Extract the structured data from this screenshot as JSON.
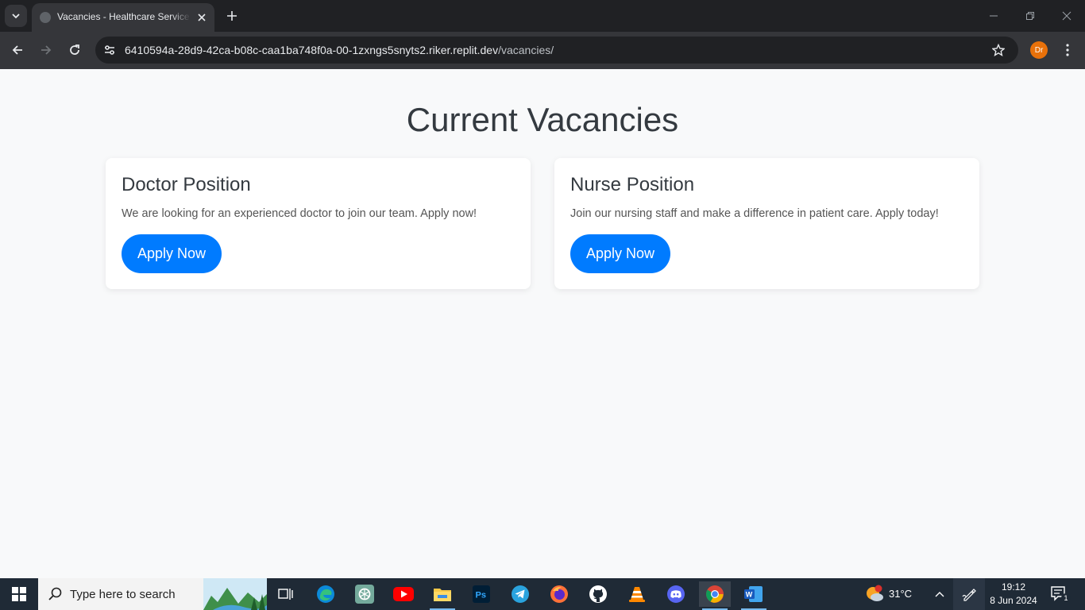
{
  "browser": {
    "tab_title": "Vacancies - Healthcare Service Management",
    "url_host": "6410594a-28d9-42ca-b08c-caa1ba748f0a-00-1zxngs5snyts2.riker.replit.dev",
    "url_path": "/vacancies/",
    "profile_initials": "Dr"
  },
  "page": {
    "title": "Current Vacancies",
    "vacancies": [
      {
        "title": "Doctor Position",
        "description": "We are looking for an experienced doctor to join our team. Apply now!",
        "button_label": "Apply Now"
      },
      {
        "title": "Nurse Position",
        "description": "Join our nursing staff and make a difference in patient care. Apply today!",
        "button_label": "Apply Now"
      }
    ]
  },
  "taskbar": {
    "search_placeholder": "Type here to search",
    "weather": "31°C",
    "time": "19:12",
    "date": "8 Jun 2024",
    "notification_count": "1",
    "apps": [
      "task-view-icon",
      "edge-icon",
      "chatgpt-icon",
      "youtube-icon",
      "file-explorer-icon",
      "photoshop-icon",
      "telegram-icon",
      "firefox-icon",
      "github-icon",
      "vlc-icon",
      "discord-icon",
      "chrome-icon",
      "word-icon"
    ]
  },
  "colors": {
    "primary_button": "#007bff",
    "page_background": "#f8f9fa",
    "heading": "#343a40"
  }
}
